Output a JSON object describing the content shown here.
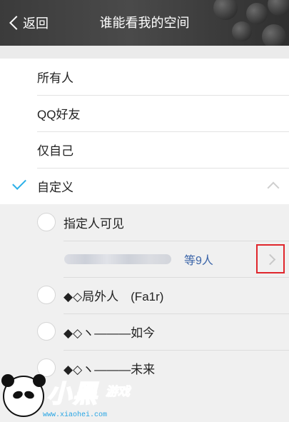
{
  "header": {
    "back_label": "返回",
    "title": "谁能看我的空间"
  },
  "visibility_options": [
    {
      "label": "所有人",
      "selected": false
    },
    {
      "label": "QQ好友",
      "selected": false
    },
    {
      "label": "仅自己",
      "selected": false
    },
    {
      "label": "自定义",
      "selected": true,
      "expanded": true
    }
  ],
  "custom": {
    "specified_visible": {
      "label": "指定人可见",
      "checked": false
    },
    "specified_count": "等9人",
    "groups": [
      {
        "label": "◆◇局外人　(Fa1r)",
        "checked": false
      },
      {
        "label": "◆◇ヽ———如今",
        "checked": false
      },
      {
        "label": "◆◇ヽ———未来",
        "checked": false
      }
    ]
  },
  "watermark": {
    "brand": "小黑",
    "suffix": "游戏",
    "url": "www.xiaohei.com"
  },
  "colors": {
    "accent_check": "#2bb0e8",
    "count_text": "#3a64a8",
    "highlight_box": "#e0262c",
    "header_bg": "#3b3b3b"
  }
}
